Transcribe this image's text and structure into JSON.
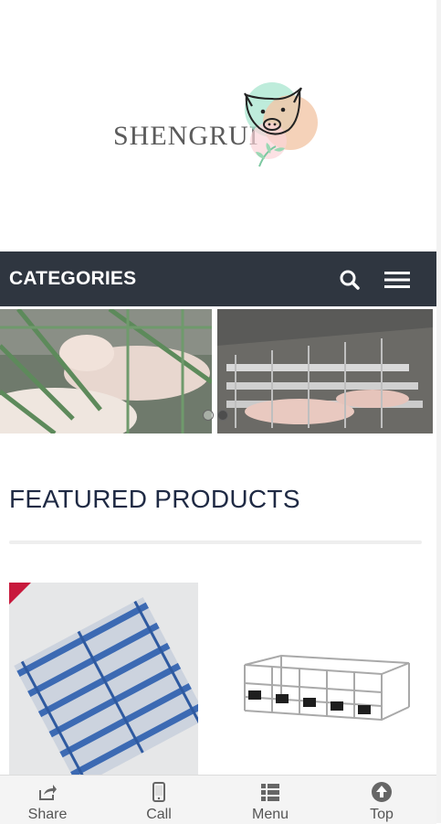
{
  "logo": {
    "text": "SHENGRUI"
  },
  "categories_bar": {
    "title": "CATEGORIES",
    "search_icon": "search-icon",
    "menu_icon": "hamburger-menu-icon"
  },
  "slider": {
    "slides": [
      {
        "alt": "pigs in farrowing crate"
      },
      {
        "alt": "pig barn with gestation stalls"
      }
    ],
    "total_slides": 2,
    "active_slide": 2
  },
  "featured": {
    "title": "FEATURED PRODUCTS",
    "products": [
      {
        "name": "blue plastic slatted floor",
        "badge_color": "#c8193c"
      },
      {
        "name": "galvanized gestation crate"
      }
    ]
  },
  "bottom_nav": {
    "items": [
      {
        "label": "Share",
        "icon": "share-icon"
      },
      {
        "label": "Call",
        "icon": "phone-icon"
      },
      {
        "label": "Menu",
        "icon": "list-icon"
      },
      {
        "label": "Top",
        "icon": "arrow-up-circle-icon"
      }
    ]
  },
  "colors": {
    "category_bar": "#2f3640",
    "heading_text": "#1f2a44",
    "nav_background": "#f4f4f4"
  }
}
